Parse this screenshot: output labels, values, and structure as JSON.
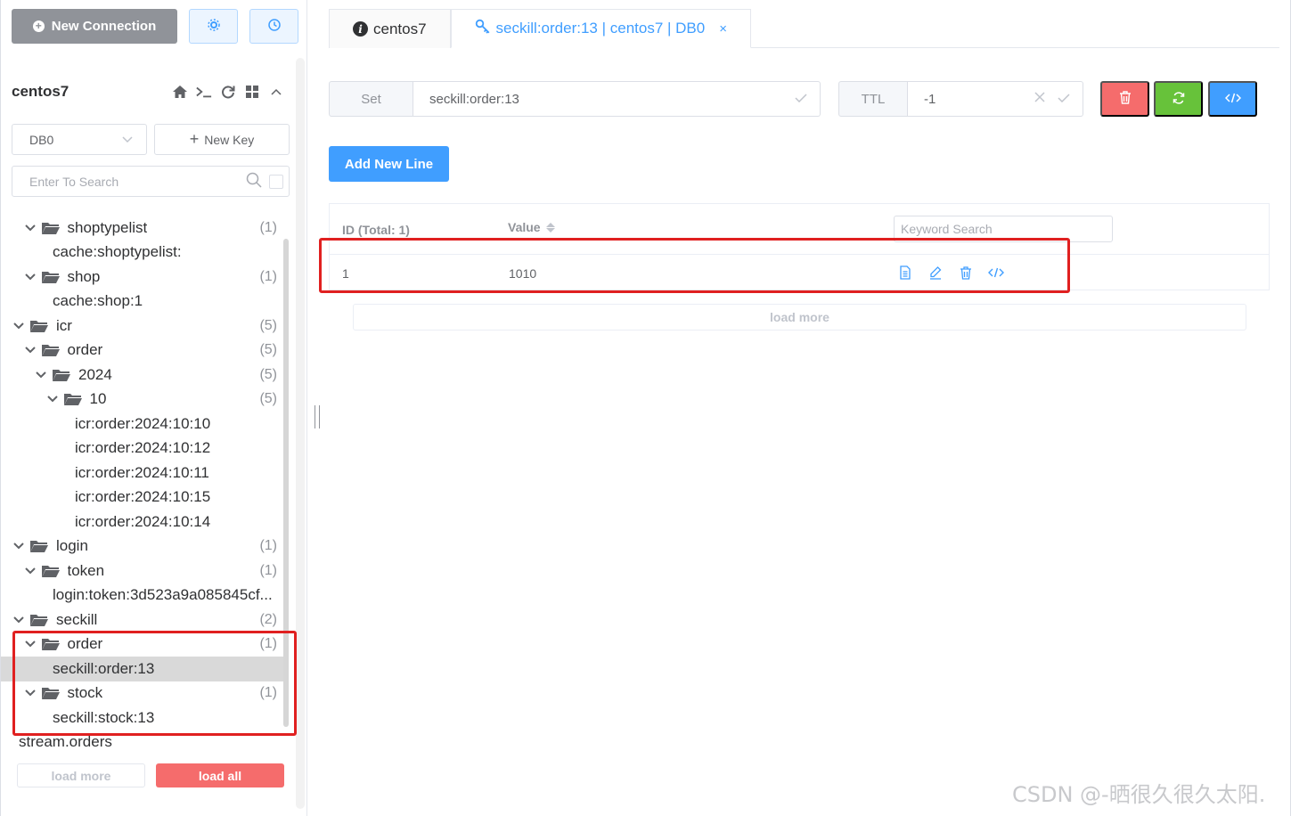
{
  "sidebar": {
    "new_connection_label": "New Connection",
    "connection_name": "centos7",
    "db_select_value": "DB0",
    "new_key_label": "New Key",
    "search_placeholder": "Enter To Search",
    "load_more_label": "load more",
    "load_all_label": "load all",
    "tree": [
      {
        "label": "shoptypelist",
        "count": "(1)",
        "type": "folder"
      },
      {
        "label": "cache:shoptypelist:",
        "count": "",
        "type": "key"
      },
      {
        "label": "shop",
        "count": "(1)",
        "type": "folder"
      },
      {
        "label": "cache:shop:1",
        "count": "",
        "type": "key"
      },
      {
        "label": "icr",
        "count": "(5)",
        "type": "folder"
      },
      {
        "label": "order",
        "count": "(5)",
        "type": "folder"
      },
      {
        "label": "2024",
        "count": "(5)",
        "type": "folder"
      },
      {
        "label": "10",
        "count": "(5)",
        "type": "folder"
      },
      {
        "label": "icr:order:2024:10:10",
        "count": "",
        "type": "key"
      },
      {
        "label": "icr:order:2024:10:12",
        "count": "",
        "type": "key"
      },
      {
        "label": "icr:order:2024:10:11",
        "count": "",
        "type": "key"
      },
      {
        "label": "icr:order:2024:10:15",
        "count": "",
        "type": "key"
      },
      {
        "label": "icr:order:2024:10:14",
        "count": "",
        "type": "key"
      },
      {
        "label": "login",
        "count": "(1)",
        "type": "folder"
      },
      {
        "label": "token",
        "count": "(1)",
        "type": "folder"
      },
      {
        "label": "login:token:3d523a9a085845cf...",
        "count": "",
        "type": "key"
      },
      {
        "label": "seckill",
        "count": "(2)",
        "type": "folder"
      },
      {
        "label": "order",
        "count": "(1)",
        "type": "folder"
      },
      {
        "label": "seckill:order:13",
        "count": "",
        "type": "key",
        "selected": true
      },
      {
        "label": "stock",
        "count": "(1)",
        "type": "folder"
      },
      {
        "label": "seckill:stock:13",
        "count": "",
        "type": "key"
      },
      {
        "label": "stream.orders",
        "count": "",
        "type": "key"
      }
    ]
  },
  "tabs": [
    {
      "label": "centos7",
      "icon": "info-icon",
      "active": false
    },
    {
      "label": "seckill:order:13 | centos7 | DB0",
      "icon": "key-icon",
      "active": true,
      "close": "×"
    }
  ],
  "editor": {
    "key_type": "Set",
    "key_name": "seckill:order:13",
    "ttl_label": "TTL",
    "ttl_value": "-1",
    "add_line_label": "Add New Line",
    "table": {
      "id_header": "ID (Total: 1)",
      "value_header": "Value",
      "keyword_placeholder": "Keyword Search",
      "rows": [
        {
          "id": "1",
          "value": "1010"
        }
      ]
    },
    "load_more_label": "load more"
  },
  "watermark": "CSDN @-晒很久很久太阳.",
  "colors": {
    "accent": "#409eff",
    "danger": "#f56c6c",
    "success": "#67c23a",
    "highlight_box": "#e02020",
    "selected_row": "#d9d9d9"
  }
}
